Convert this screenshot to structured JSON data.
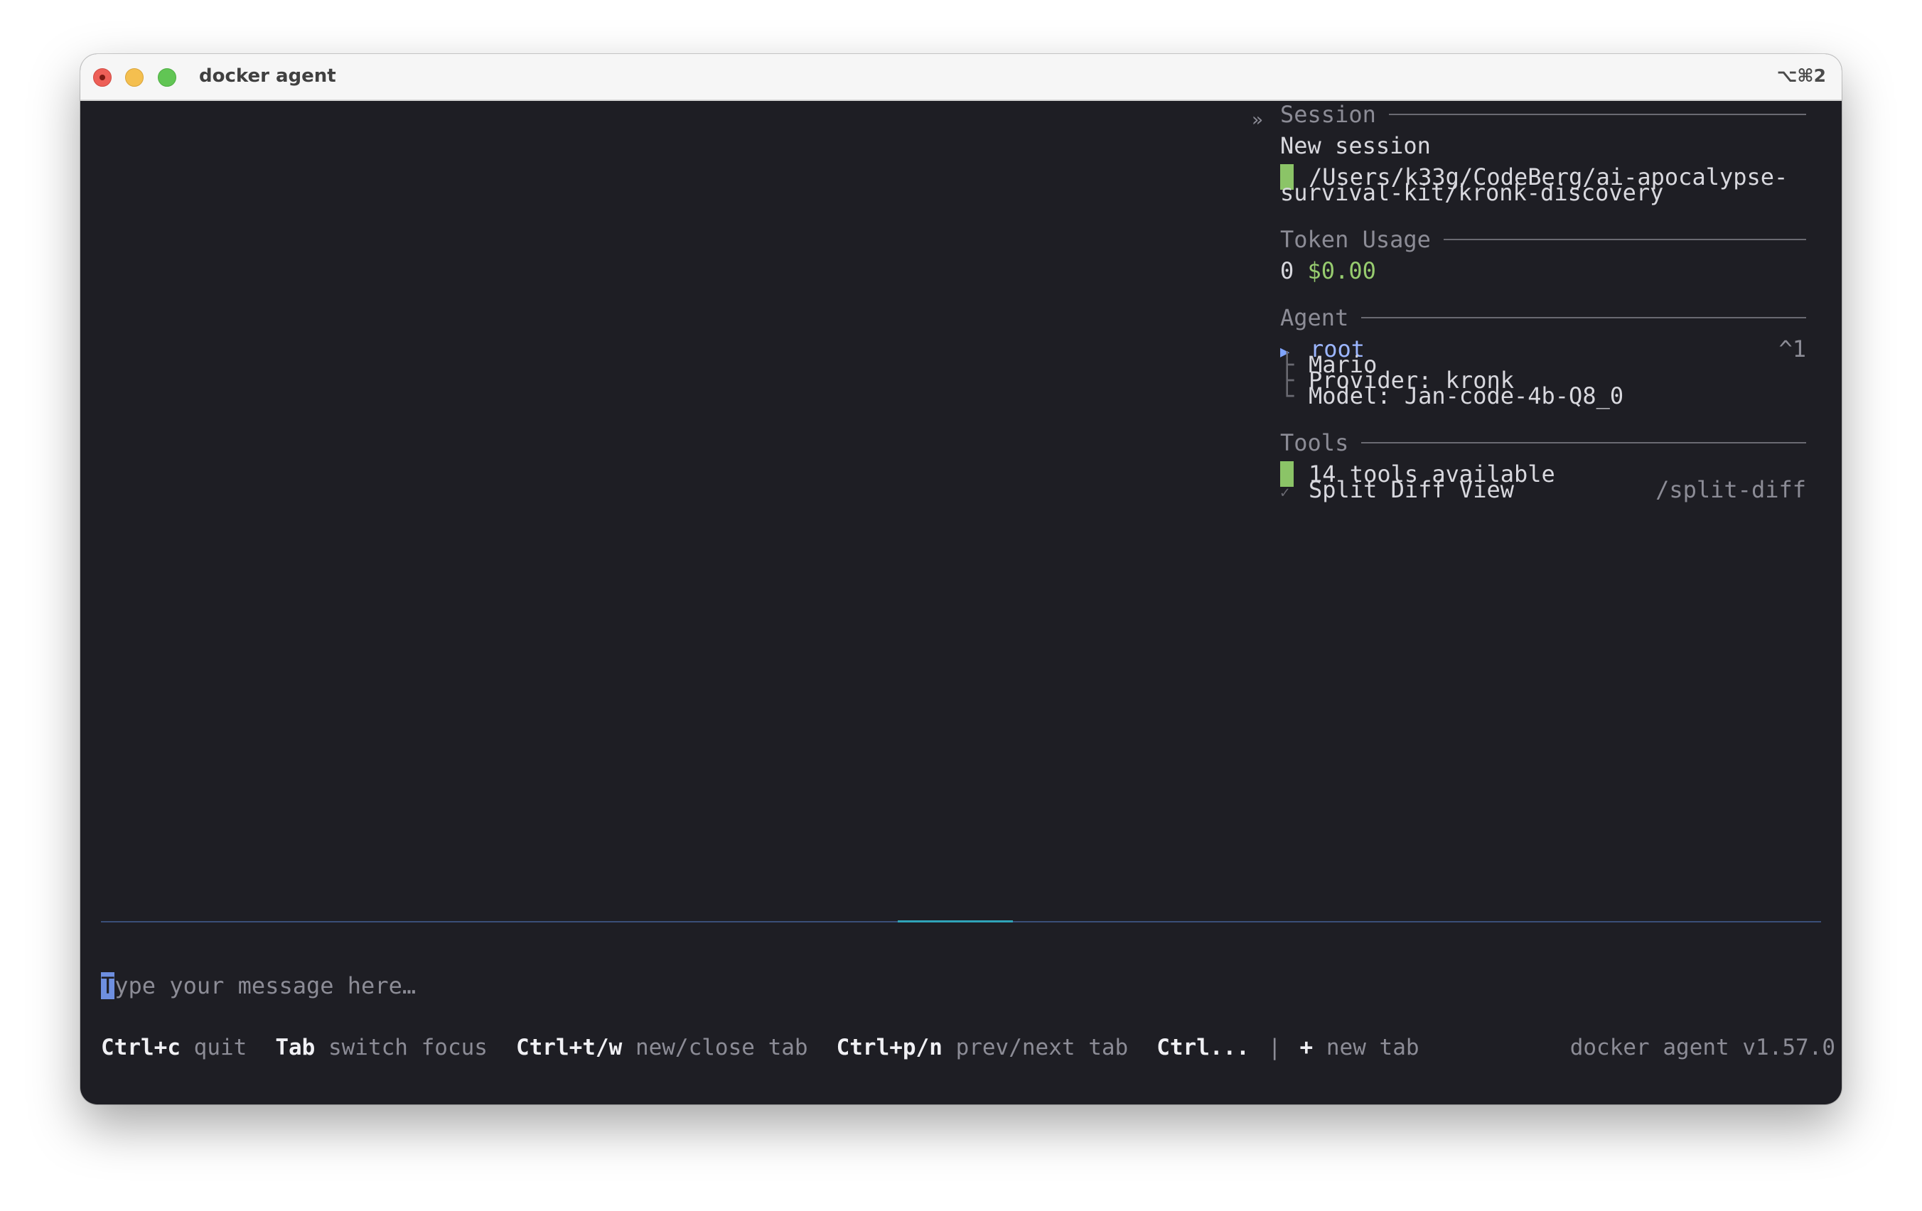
{
  "window": {
    "title": "docker agent",
    "shortcut": "⌥⌘2"
  },
  "sidebar": {
    "collapse_glyph": "»",
    "session": {
      "header": "Session",
      "name": "New session",
      "path_line1": "/Users/k33g/CodeBerg/ai-apocalypse-",
      "path_line2": "survival-kit/kronk-discovery"
    },
    "token_usage": {
      "header": "Token Usage",
      "tokens": "0",
      "cost": "$0.00"
    },
    "agent": {
      "header": "Agent",
      "name": "root",
      "hotkey": "^1",
      "description": "Mario",
      "provider": "Provider: kronk",
      "model": "Model: Jan-code-4b-Q8_0"
    },
    "tools": {
      "header": "Tools",
      "available": "14 tools available",
      "feature_label": "Split Diff View",
      "feature_command": "/split-diff"
    }
  },
  "input": {
    "cursor_char": "T",
    "placeholder_rest": "ype your message here…"
  },
  "statusbar": {
    "items": [
      {
        "key": "Ctrl+c",
        "desc": "quit"
      },
      {
        "key": "Tab",
        "desc": "switch focus"
      },
      {
        "key": "Ctrl+t/w",
        "desc": "new/close tab"
      },
      {
        "key": "Ctrl+p/n",
        "desc": "prev/next tab"
      },
      {
        "key": "Ctrl...",
        "desc": ""
      }
    ],
    "separator": "|",
    "new_tab_key": "+",
    "new_tab_label": "new tab",
    "version": "docker agent v1.57.0"
  },
  "colors": {
    "background": "#1e1e24",
    "accent_green": "#8bc467",
    "accent_blue": "#9cb6ff",
    "divider": "#3a4f78"
  }
}
